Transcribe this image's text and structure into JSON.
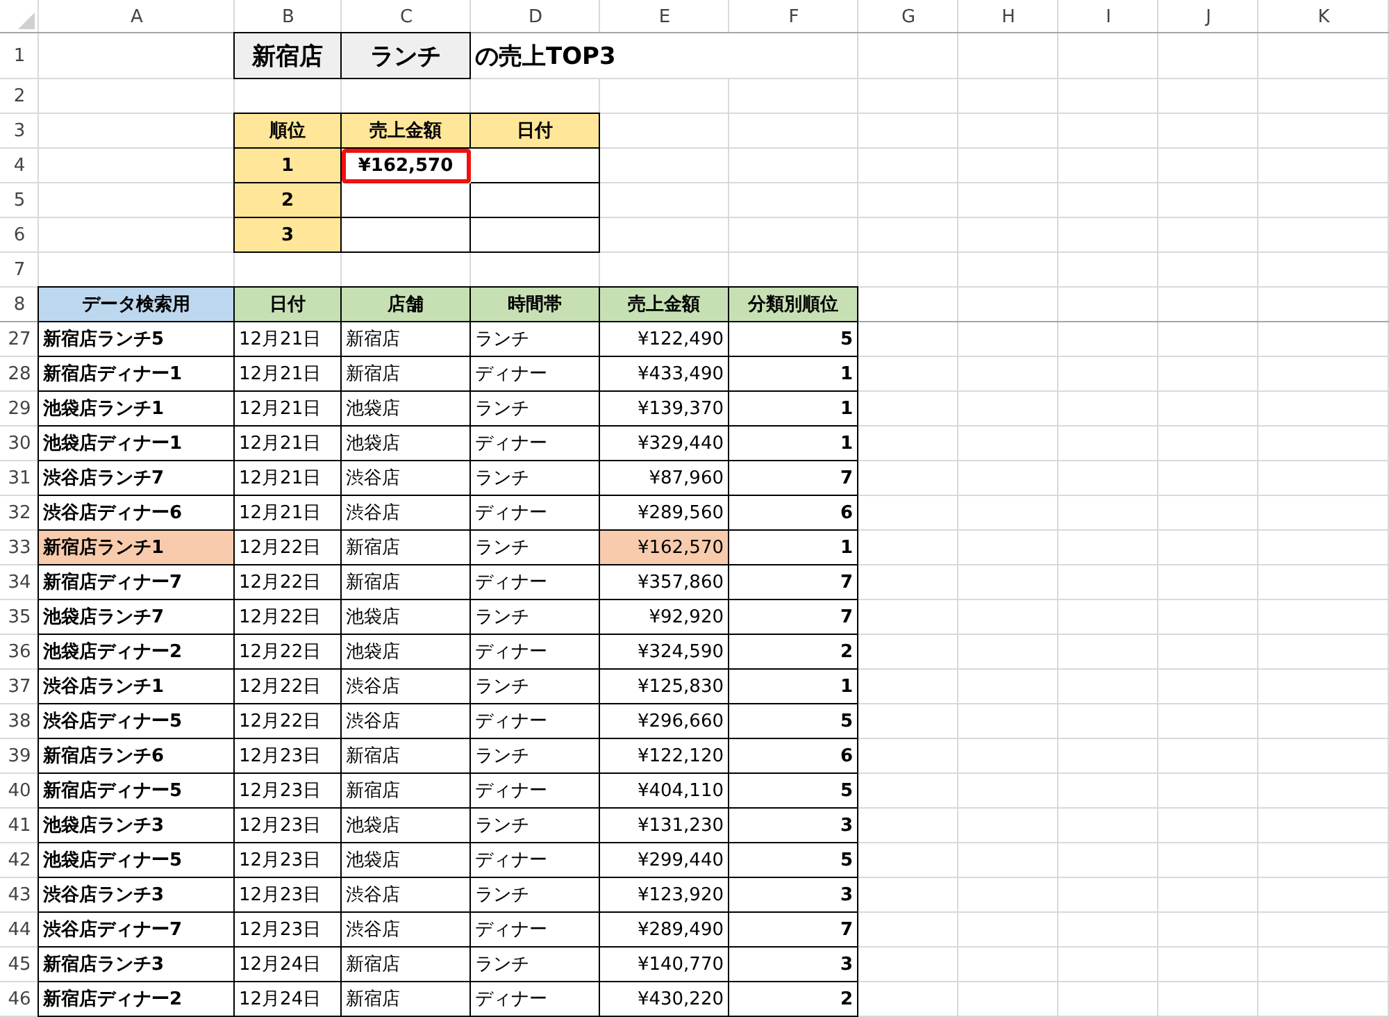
{
  "column_headers": [
    "A",
    "B",
    "C",
    "D",
    "E",
    "F",
    "G",
    "H",
    "I",
    "J",
    "K"
  ],
  "top_row_numbers": [
    "1",
    "2",
    "3",
    "4",
    "5",
    "6",
    "7",
    "8"
  ],
  "title": {
    "store": "新宿店",
    "timeslot": "ランチ",
    "suffix": "の売上TOP3"
  },
  "rank_table": {
    "columns": [
      "順位",
      "売上金額",
      "日付"
    ],
    "rows": [
      {
        "rank": "1",
        "amount": "¥162,570",
        "selected": true
      },
      {
        "rank": "2",
        "selected": false
      },
      {
        "rank": "3",
        "selected": false
      }
    ]
  },
  "data_table": {
    "columns": [
      {
        "label": "データ検索用",
        "color": "#bdd7ee"
      },
      {
        "label": "日付",
        "color": "#c6e0b4"
      },
      {
        "label": "店舗",
        "color": "#c6e0b4"
      },
      {
        "label": "時間帯",
        "color": "#c6e0b4"
      },
      {
        "label": "売上金額",
        "color": "#c6e0b4"
      },
      {
        "label": "分類別順位",
        "color": "#c6e0b4"
      }
    ],
    "rows": [
      {
        "num": "27",
        "key": "新宿店ランチ5",
        "date": "12月21日",
        "store": "新宿店",
        "time": "ランチ",
        "amount": "¥122,490",
        "rank": "5",
        "highlighted": false
      },
      {
        "num": "28",
        "key": "新宿店ディナー1",
        "date": "12月21日",
        "store": "新宿店",
        "time": "ディナー",
        "amount": "¥433,490",
        "rank": "1",
        "highlighted": false
      },
      {
        "num": "29",
        "key": "池袋店ランチ1",
        "date": "12月21日",
        "store": "池袋店",
        "time": "ランチ",
        "amount": "¥139,370",
        "rank": "1",
        "highlighted": false
      },
      {
        "num": "30",
        "key": "池袋店ディナー1",
        "date": "12月21日",
        "store": "池袋店",
        "time": "ディナー",
        "amount": "¥329,440",
        "rank": "1",
        "highlighted": false
      },
      {
        "num": "31",
        "key": "渋谷店ランチ7",
        "date": "12月21日",
        "store": "渋谷店",
        "time": "ランチ",
        "amount": "¥87,960",
        "rank": "7",
        "highlighted": false
      },
      {
        "num": "32",
        "key": "渋谷店ディナー6",
        "date": "12月21日",
        "store": "渋谷店",
        "time": "ディナー",
        "amount": "¥289,560",
        "rank": "6",
        "highlighted": false
      },
      {
        "num": "33",
        "key": "新宿店ランチ1",
        "date": "12月22日",
        "store": "新宿店",
        "time": "ランチ",
        "amount": "¥162,570",
        "rank": "1",
        "highlighted": true
      },
      {
        "num": "34",
        "key": "新宿店ディナー7",
        "date": "12月22日",
        "store": "新宿店",
        "time": "ディナー",
        "amount": "¥357,860",
        "rank": "7",
        "highlighted": false
      },
      {
        "num": "35",
        "key": "池袋店ランチ7",
        "date": "12月22日",
        "store": "池袋店",
        "time": "ランチ",
        "amount": "¥92,920",
        "rank": "7",
        "highlighted": false
      },
      {
        "num": "36",
        "key": "池袋店ディナー2",
        "date": "12月22日",
        "store": "池袋店",
        "time": "ディナー",
        "amount": "¥324,590",
        "rank": "2",
        "highlighted": false
      },
      {
        "num": "37",
        "key": "渋谷店ランチ1",
        "date": "12月22日",
        "store": "渋谷店",
        "time": "ランチ",
        "amount": "¥125,830",
        "rank": "1",
        "highlighted": false
      },
      {
        "num": "38",
        "key": "渋谷店ディナー5",
        "date": "12月22日",
        "store": "渋谷店",
        "time": "ディナー",
        "amount": "¥296,660",
        "rank": "5",
        "highlighted": false
      },
      {
        "num": "39",
        "key": "新宿店ランチ6",
        "date": "12月23日",
        "store": "新宿店",
        "time": "ランチ",
        "amount": "¥122,120",
        "rank": "6",
        "highlighted": false
      },
      {
        "num": "40",
        "key": "新宿店ディナー5",
        "date": "12月23日",
        "store": "新宿店",
        "time": "ディナー",
        "amount": "¥404,110",
        "rank": "5",
        "highlighted": false
      },
      {
        "num": "41",
        "key": "池袋店ランチ3",
        "date": "12月23日",
        "store": "池袋店",
        "time": "ランチ",
        "amount": "¥131,230",
        "rank": "3",
        "highlighted": false
      },
      {
        "num": "42",
        "key": "池袋店ディナー5",
        "date": "12月23日",
        "store": "池袋店",
        "time": "ディナー",
        "amount": "¥299,440",
        "rank": "5",
        "highlighted": false
      },
      {
        "num": "43",
        "key": "渋谷店ランチ3",
        "date": "12月23日",
        "store": "渋谷店",
        "time": "ランチ",
        "amount": "¥123,920",
        "rank": "3",
        "highlighted": false
      },
      {
        "num": "44",
        "key": "渋谷店ディナー7",
        "date": "12月23日",
        "store": "渋谷店",
        "time": "ディナー",
        "amount": "¥289,490",
        "rank": "7",
        "highlighted": false
      },
      {
        "num": "45",
        "key": "新宿店ランチ3",
        "date": "12月24日",
        "store": "新宿店",
        "time": "ランチ",
        "amount": "¥140,770",
        "rank": "3",
        "highlighted": false
      },
      {
        "num": "46",
        "key": "新宿店ディナー2",
        "date": "12月24日",
        "store": "新宿店",
        "time": "ディナー",
        "amount": "¥430,220",
        "rank": "2",
        "highlighted": false
      }
    ]
  }
}
